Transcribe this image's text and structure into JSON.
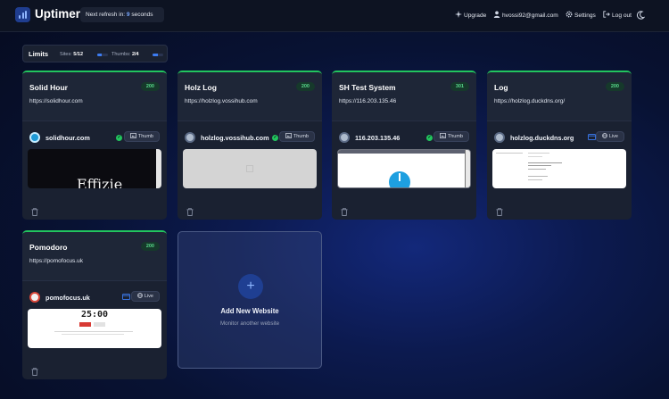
{
  "app": {
    "name": "Uptimer"
  },
  "header": {
    "refresh_prefix": "Next refresh in:",
    "refresh_seconds": "9",
    "refresh_suffix": "seconds",
    "upgrade": "Upgrade",
    "user_email": "hvossi92@gmail.com",
    "settings": "Settings",
    "logout": "Log out"
  },
  "limits": {
    "title": "Limits",
    "sites_label": "Sites:",
    "sites_value": "5/12",
    "sites_fraction": 0.4167,
    "thumbs_label": "Thumbs:",
    "thumbs_value": "2/4",
    "thumbs_fraction": 0.5
  },
  "colors": {
    "accent": "#3c7cf2",
    "status_ok": "#22c55e",
    "status_text": "#57d88a"
  },
  "cards": [
    {
      "title": "Solid Hour",
      "status": "200",
      "url": "https://solidhour.com",
      "host": "solidhour.com",
      "mode": "Thumb",
      "mode_icon": "image-icon",
      "preview_text": "Effizie"
    },
    {
      "title": "Holz Log",
      "status": "200",
      "url": "https://holzlog.vossihub.com",
      "host": "holzlog.vossihub.com",
      "mode": "Thumb",
      "mode_icon": "image-icon"
    },
    {
      "title": "SH Test System",
      "status": "301",
      "url": "https://116.203.135.46",
      "host": "116.203.135.46",
      "mode": "Thumb",
      "mode_icon": "image-icon"
    },
    {
      "title": "Log",
      "status": "200",
      "url": "https://holzlog.duckdns.org/",
      "host": "holzlog.duckdns.org",
      "mode": "Live",
      "mode_icon": "globe-icon"
    },
    {
      "title": "Pomodoro",
      "status": "200",
      "url": "https://pomofocus.uk",
      "host": "pomofocus.uk",
      "mode": "Live",
      "mode_icon": "globe-icon",
      "preview_text": "25:00"
    }
  ],
  "add_card": {
    "title": "Add New Website",
    "subtitle": "Monitor another website"
  }
}
